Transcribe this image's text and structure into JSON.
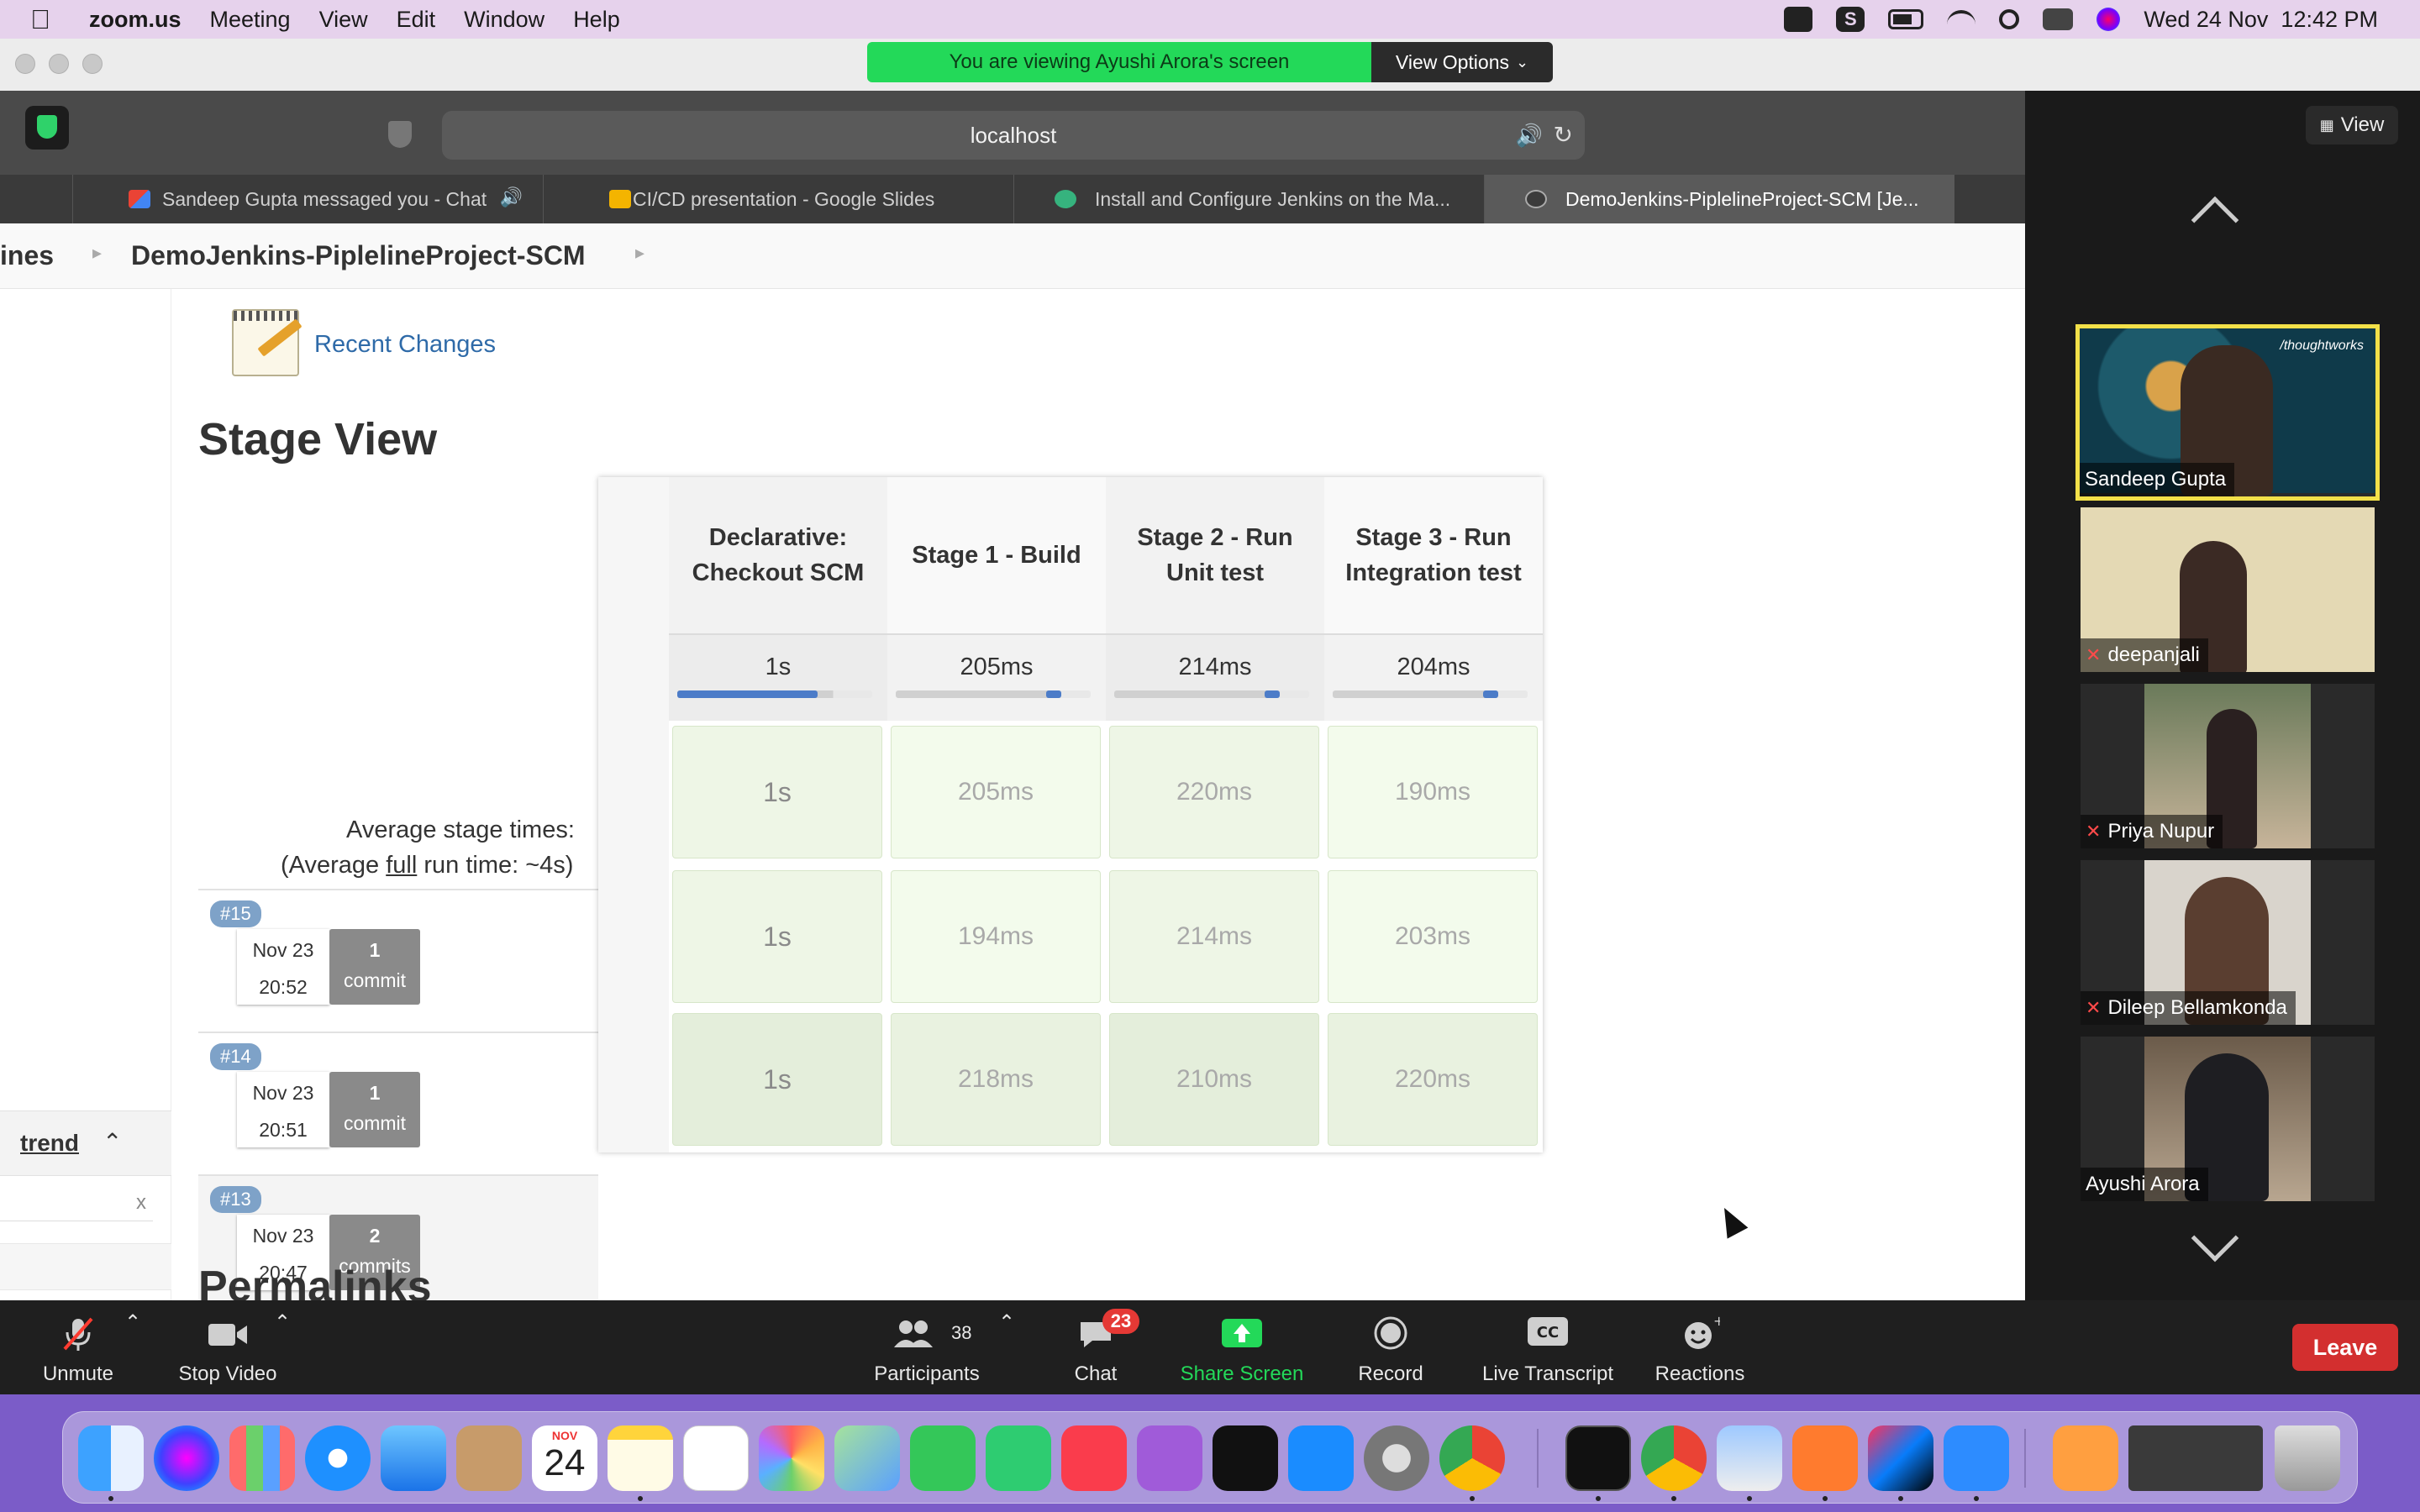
{
  "menubar": {
    "app_name": "zoom.us",
    "menus": [
      "Meeting",
      "View",
      "Edit",
      "Window",
      "Help"
    ],
    "clock": "Wed 24 Nov  12:42 PM",
    "status_icons": [
      "zoom-camera-icon",
      "skype-icon",
      "battery-icon",
      "wifi-icon",
      "spotlight-icon",
      "control-center-icon",
      "siri-icon"
    ]
  },
  "zoom": {
    "viewing_banner": "You are viewing Ayushi Arora's screen",
    "view_options_label": "View Options",
    "view_button_label": "View",
    "toolbar": {
      "unmute": "Unmute",
      "stop_video": "Stop Video",
      "participants": "Participants",
      "participants_count": "38",
      "chat": "Chat",
      "chat_badge": "23",
      "share_screen": "Share Screen",
      "record": "Record",
      "live_transcript": "Live Transcript",
      "reactions": "Reactions",
      "leave": "Leave"
    },
    "participants": [
      {
        "name": "Sandeep Gupta",
        "muted": false,
        "active_speaker": true,
        "watermark": "/thoughtworks"
      },
      {
        "name": "deepanjali",
        "muted": true
      },
      {
        "name": "Priya Nupur",
        "muted": true
      },
      {
        "name": "Dileep Bellamkonda",
        "muted": true
      },
      {
        "name": "Ayushi Arora",
        "muted": false
      }
    ]
  },
  "browser": {
    "url": "localhost",
    "tabs": [
      {
        "title": "Sandeep Gupta messaged you - Chat",
        "icon": "gmail-icon",
        "active": false
      },
      {
        "title": "CI/CD presentation - Google Slides",
        "icon": "slides-icon",
        "active": false
      },
      {
        "title": "Install and Configure Jenkins on the Ma...",
        "icon": "globe-icon",
        "active": false
      },
      {
        "title": "DemoJenkins-PiplelineProject-SCM [Je...",
        "icon": "jenkins-icon",
        "active": true
      }
    ]
  },
  "jenkins": {
    "breadcrumb": [
      "ines",
      "DemoJenkins-PiplelineProject-SCM"
    ],
    "recent_changes": "Recent Changes",
    "stage_view_title": "Stage View",
    "avg_label": "Average stage times:",
    "avg_full_prefix": "(Average ",
    "avg_full_word": "full",
    "avg_full_suffix": " run time: ~4s)",
    "trend_label": "trend",
    "filter_clear": "x",
    "next_heading_peek": "Permalinks",
    "stages": [
      {
        "header": "Declarative: Checkout SCM",
        "avg": "1s",
        "avg_fraction": 0.72
      },
      {
        "header": "Stage 1 - Build",
        "avg": "205ms",
        "avg_fraction": 0.08
      },
      {
        "header": "Stage 2 - Run Unit test",
        "avg": "214ms",
        "avg_fraction": 0.08
      },
      {
        "header": "Stage 3 - Run Integration test",
        "avg": "204ms",
        "avg_fraction": 0.08
      }
    ],
    "runs": [
      {
        "badge": "#15",
        "date": "Nov 23",
        "time": "20:52",
        "commit_count": "1",
        "commit_word": "commit",
        "cells": [
          "1s",
          "205ms",
          "220ms",
          "190ms"
        ]
      },
      {
        "badge": "#14",
        "date": "Nov 23",
        "time": "20:51",
        "commit_count": "1",
        "commit_word": "commit",
        "cells": [
          "1s",
          "194ms",
          "214ms",
          "203ms"
        ]
      },
      {
        "badge": "#13",
        "date": "Nov 23",
        "time": "20:47",
        "commit_count": "2",
        "commit_word": "commits",
        "cells": [
          "1s",
          "218ms",
          "210ms",
          "220ms"
        ]
      }
    ]
  },
  "dock": {
    "calendar_month": "NOV",
    "calendar_day": "24",
    "apps": [
      "finder-icon",
      "siri-icon",
      "launchpad-icon",
      "safari-icon",
      "mail-icon",
      "contacts-icon",
      "calendar-icon",
      "notes-icon",
      "reminders-icon",
      "photos-icon",
      "maps-icon",
      "messages-icon",
      "facetime-icon",
      "music-icon",
      "podcasts-icon",
      "apple-tv-icon",
      "app-store-icon",
      "system-preferences-icon",
      "chrome-icon",
      "terminal-icon",
      "chrome-icon",
      "preview-icon",
      "sketch-icon",
      "intellij-icon",
      "zoom-icon",
      "pages-icon",
      "window-thumbnails-icon",
      "trash-icon"
    ]
  },
  "colors": {
    "banner_green": "#23d959",
    "leave_red": "#d32f2f",
    "active_speaker_border": "#f2e049",
    "link_blue": "#2e6aa8",
    "stage_bar_blue": "#4c7cc8"
  }
}
